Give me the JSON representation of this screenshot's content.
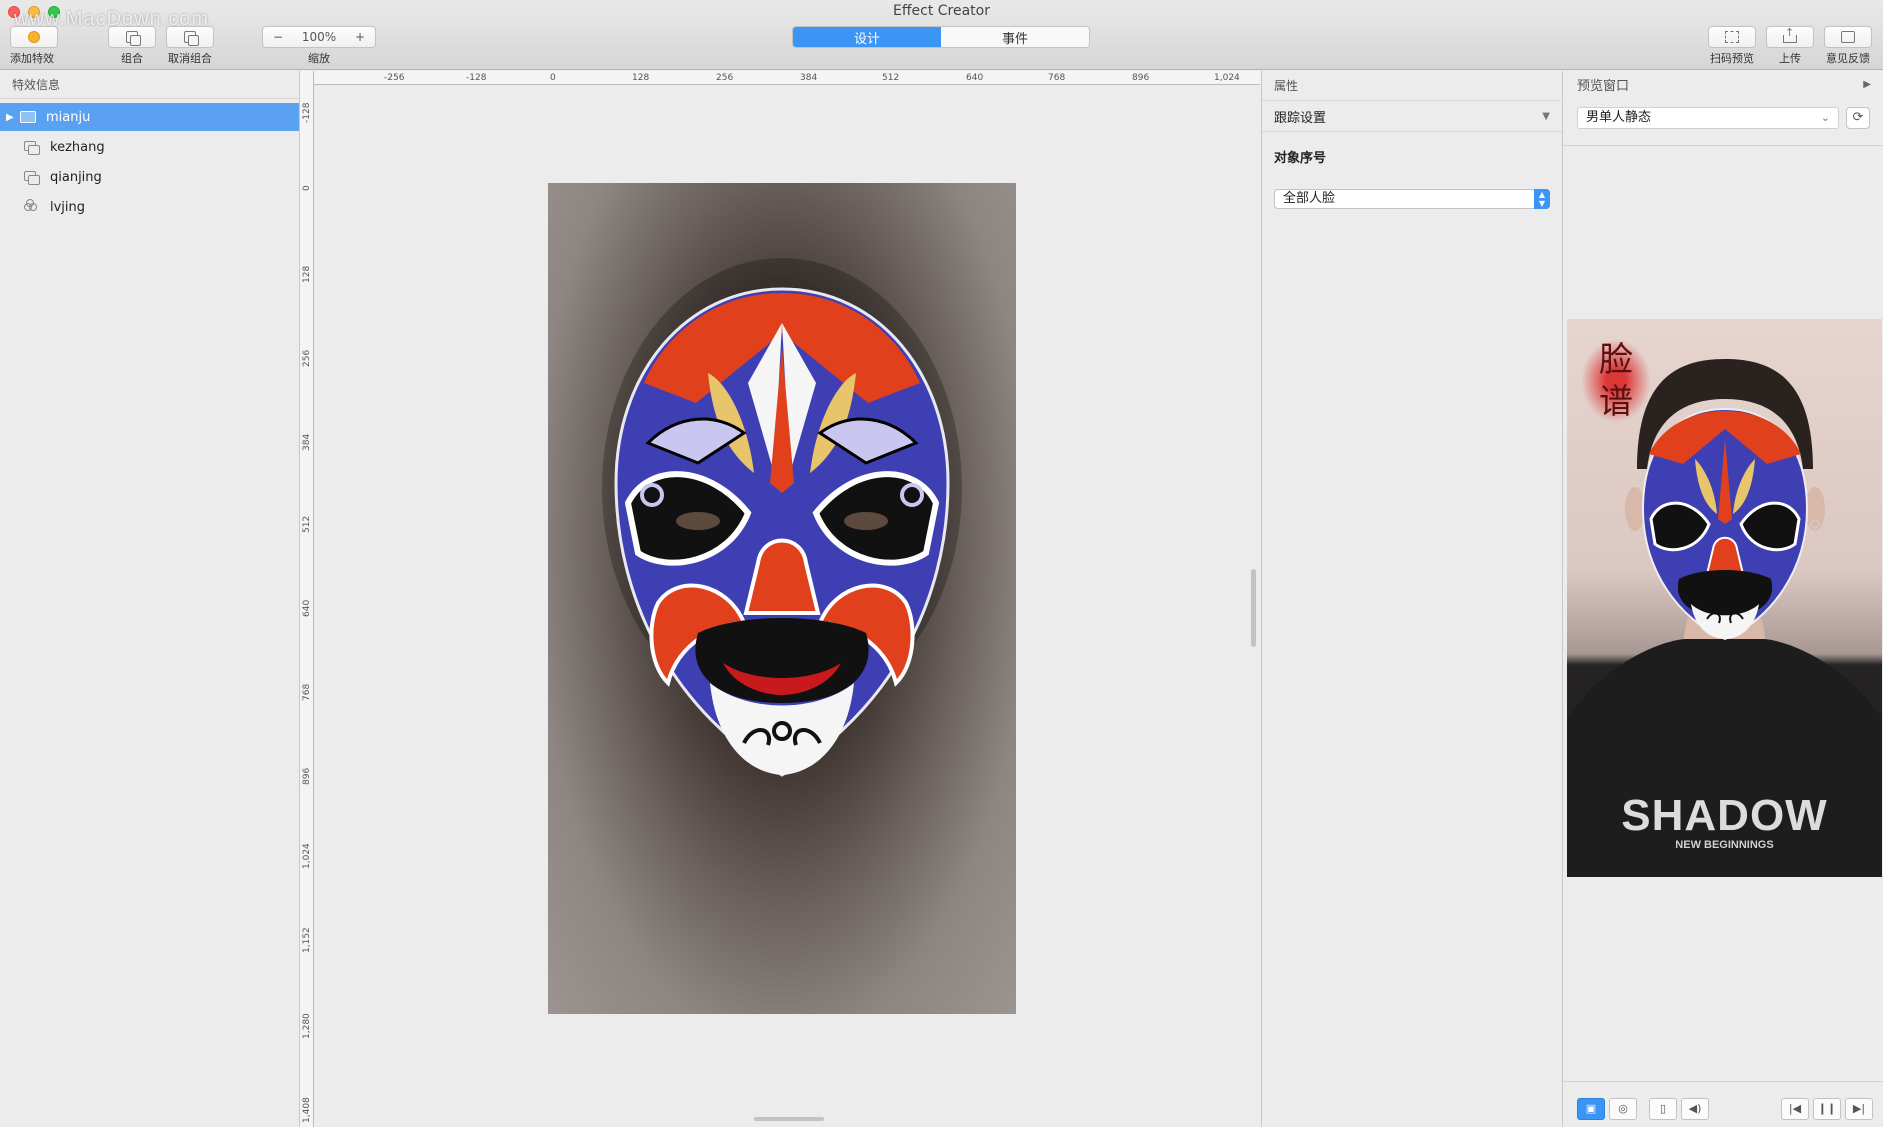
{
  "window": {
    "title": "Effect Creator",
    "watermark": "www.MacDown.com"
  },
  "toolbar": {
    "add_effect_label": "添加特效",
    "group_label": "组合",
    "ungroup_label": "取消组合",
    "zoom_value": "100%",
    "zoom_minus": "−",
    "zoom_plus": "+",
    "zoom_label": "缩放",
    "tabs": [
      {
        "label": "设计",
        "active": true
      },
      {
        "label": "事件",
        "active": false
      }
    ],
    "scan_preview_label": "扫码预览",
    "upload_label": "上传",
    "feedback_label": "意见反馈"
  },
  "left_panel": {
    "header": "特效信息",
    "items": [
      {
        "label": "mianju",
        "icon": "folder-icon",
        "selected": true
      },
      {
        "label": "kezhang",
        "icon": "layer-icon",
        "selected": false
      },
      {
        "label": "qianjing",
        "icon": "layer-icon",
        "selected": false
      },
      {
        "label": "lvjing",
        "icon": "filter-icon",
        "selected": false
      }
    ]
  },
  "canvas": {
    "ruler_top": [
      "-256",
      "-128",
      "0",
      "128",
      "256",
      "384",
      "512",
      "640",
      "768",
      "896",
      "1,024"
    ],
    "ruler_left": [
      "-128",
      "0",
      "128",
      "256",
      "384",
      "512",
      "640",
      "768",
      "896",
      "1,024",
      "1,152",
      "1,280",
      "1,408"
    ],
    "artboard_image": "peking-opera-mask"
  },
  "properties": {
    "header": "属性",
    "section": "跟踪设置",
    "field_label": "对象序号",
    "field_value": "全部人脸"
  },
  "preview": {
    "header": "预览窗口",
    "selected_template": "男单人静态",
    "image_text_main": "SHADOW",
    "image_text_sub": "NEW BEGINNINGS"
  },
  "colors": {
    "accent": "#3a95f4",
    "selection": "#5aa1f2",
    "mask_blue": "#3f3fb4",
    "mask_red": "#e0401c"
  }
}
